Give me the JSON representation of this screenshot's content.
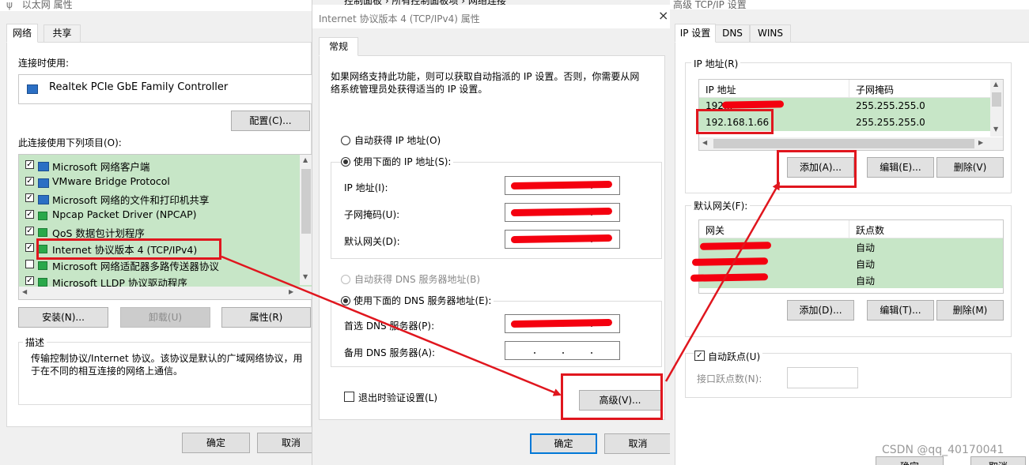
{
  "d1": {
    "title": "以太网 属性",
    "tabs": [
      "网络",
      "共享"
    ],
    "connect_using_label": "连接时使用:",
    "adapter": "Realtek PCIe GbE Family Controller",
    "configure_btn": "配置(C)...",
    "items_label": "此连接使用下列项目(O):",
    "items": [
      {
        "label": "Microsoft 网络客户端",
        "checked": true,
        "icon": "network-client-icon"
      },
      {
        "label": "VMware Bridge Protocol",
        "checked": true,
        "icon": "network-client-icon"
      },
      {
        "label": "Microsoft 网络的文件和打印机共享",
        "checked": true,
        "icon": "network-client-icon"
      },
      {
        "label": "Npcap Packet Driver (NPCAP)",
        "checked": true,
        "icon": "protocol-icon"
      },
      {
        "label": "QoS 数据包计划程序",
        "checked": true,
        "icon": "protocol-icon"
      },
      {
        "label": "Internet 协议版本 4 (TCP/IPv4)",
        "checked": true,
        "icon": "protocol-icon"
      },
      {
        "label": "Microsoft 网络适配器多路传送器协议",
        "checked": false,
        "icon": "protocol-icon"
      },
      {
        "label": "Microsoft LLDP 协议驱动程序",
        "checked": true,
        "icon": "protocol-icon"
      }
    ],
    "install_btn": "安装(N)...",
    "uninstall_btn": "卸载(U)",
    "properties_btn": "属性(R)",
    "description_label": "描述",
    "description": "传输控制协议/Internet 协议。该协议是默认的广域网络协议，用于在不同的相互连接的网络上通信。",
    "ok_btn": "确定",
    "cancel_btn": "取消"
  },
  "d2": {
    "bg_title": "控制面板 › 所有控制面板项 › 网络连接",
    "title": "Internet 协议版本 4 (TCP/IPv4) 属性",
    "tab": "常规",
    "intro": "如果网络支持此功能，则可以获取自动指派的 IP 设置。否则，你需要从网络系统管理员处获得适当的 IP 设置。",
    "auto_ip": "自动获得 IP 地址(O)",
    "manual_ip": "使用下面的 IP 地址(S):",
    "ip_label": "IP 地址(I):",
    "mask_label": "子网掩码(U):",
    "gateway_label": "默认网关(D):",
    "auto_dns": "自动获得 DNS 服务器地址(B)",
    "manual_dns": "使用下面的 DNS 服务器地址(E):",
    "dns1_label": "首选 DNS 服务器(P):",
    "dns2_label": "备用 DNS 服务器(A):",
    "validate": "退出时验证设置(L)",
    "advanced_btn": "高级(V)...",
    "ok_btn": "确定",
    "cancel_btn": "取消"
  },
  "d3": {
    "title": "高级 TCP/IP 设置",
    "tabs": [
      "IP 设置",
      "DNS",
      "WINS"
    ],
    "ip_group": "IP 地址(R)",
    "ip_headers": [
      "IP 地址",
      "子网掩码"
    ],
    "ip_rows": [
      {
        "ip": "192...",
        "mask": "255.255.255.0"
      },
      {
        "ip": "192.168.1.66",
        "mask": "255.255.255.0"
      }
    ],
    "add_btn": "添加(A)...",
    "edit_btn": "编辑(E)...",
    "delete_btn": "删除(V)",
    "gw_group": "默认网关(F):",
    "gw_headers": [
      "网关",
      "跃点数"
    ],
    "gw_rows": [
      "自动",
      "自动",
      "自动"
    ],
    "gw_add_btn": "添加(D)...",
    "gw_edit_btn": "编辑(T)...",
    "gw_delete_btn": "删除(M)",
    "auto_metric": "自动跃点(U)",
    "metric_label": "接口跃点数(N):",
    "ok_btn": "确定",
    "cancel_btn": "取消"
  },
  "watermark": "CSDN @qq_40170041",
  "annotation_color": "#e0161e"
}
